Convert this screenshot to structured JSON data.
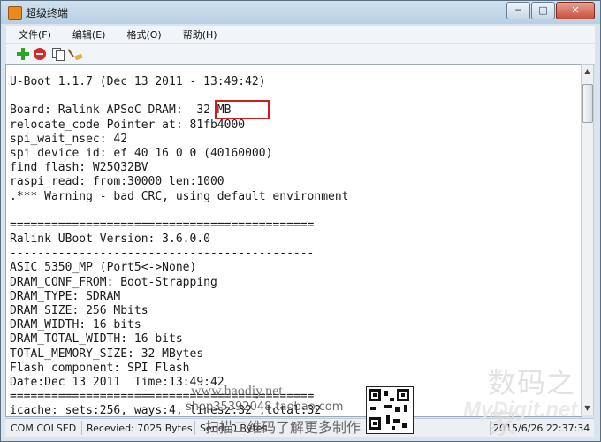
{
  "window": {
    "title": "超级终端",
    "controls": {
      "minimize": "─",
      "restore": "□",
      "close": "✕"
    }
  },
  "menu": {
    "items": [
      {
        "label": "文件(F)"
      },
      {
        "label": "编辑(E)"
      },
      {
        "label": "格式(O)"
      },
      {
        "label": "帮助(H)"
      }
    ]
  },
  "toolbar": {
    "icons": [
      "plus-icon",
      "minus-icon",
      "copy-icon",
      "broom-icon"
    ],
    "colors": {
      "plus": "#2aa52a",
      "minus": "#d42a2a"
    }
  },
  "terminal": {
    "lines": [
      "U-Boot 1.1.7 (Dec 13 2011 - 13:49:42)",
      "",
      "Board: Ralink APSoC DRAM:  32 MB",
      "relocate_code Pointer at: 81fb4000",
      "spi_wait_nsec: 42",
      "spi device id: ef 40 16 0 0 (40160000)",
      "find flash: W25Q32BV",
      "raspi_read: from:30000 len:1000",
      ".*** Warning - bad CRC, using default environment",
      "",
      "============================================",
      "Ralink UBoot Version: 3.6.0.0",
      "--------------------------------------------",
      "ASIC 5350_MP (Port5<->None)",
      "DRAM_CONF_FROM: Boot-Strapping",
      "DRAM_TYPE: SDRAM",
      "DRAM_SIZE: 256 Mbits",
      "DRAM_WIDTH: 16 bits",
      "DRAM_TOTAL_WIDTH: 16 bits",
      "TOTAL_MEMORY_SIZE: 32 MBytes",
      "Flash component: SPI Flash",
      "Date:Dec 13 2011  Time:13:49:42",
      "============================================",
      "icache: sets:256, ways:4, linesz:32 ,total:32"
    ],
    "highlight_color": "#d11b1b"
  },
  "status": {
    "port": "COM COLSED",
    "received": "Recevied: 7025 Bytes",
    "send": "Send: 0 Bytes",
    "datetime": "2015/6/26 22:37:34"
  },
  "watermark": {
    "logo": "数码之家",
    "site": "MyDigit.net",
    "url": "www.haodiy.net",
    "shop": "shop35392048.taobao.com",
    "scan": "扫描二维码了解更多制作"
  }
}
